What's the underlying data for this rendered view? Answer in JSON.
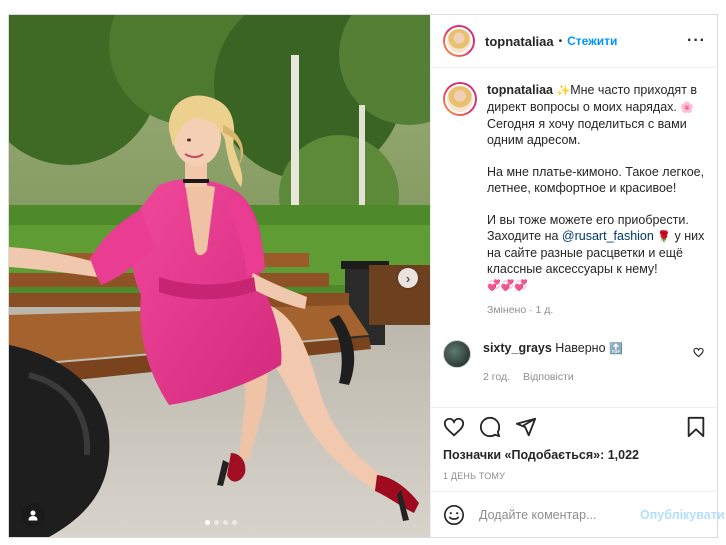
{
  "post": {
    "username": "topnataliaa",
    "bullet": "•",
    "follow_label": "Стежити",
    "more_label": "···"
  },
  "caption": {
    "username": "topnataliaa",
    "p1_a": "Мне часто приходят в директ вопросы о моих нарядах.",
    "p1_b": "Сегодня я хочу поделиться с вами одним адресом.",
    "p2": "На мне платье-кимоно. Такое легкое, летнее, комфортное и красивое!",
    "p3_a": "И вы тоже можете его приобрести. Заходите на",
    "p3_mention": "@rusart_fashion",
    "p3_b": "у них на сайте разные расцветки и ещё классные аксессуары к нему!",
    "emoji_prefix": "✨",
    "emoji_flower": "🌸",
    "emoji_rose": "🌹",
    "hearts": "💞💞💞",
    "meta": "Змінено · 1 д."
  },
  "comment": {
    "username": "sixty_grays",
    "text": "Наверно",
    "emoji": "🔝",
    "time": "2 год.",
    "reply_label": "Відповісти"
  },
  "actions": {
    "likes_text": "Позначки «Подобається»: 1,022",
    "timestamp": "1 ДЕНЬ ТОМУ"
  },
  "comment_box": {
    "placeholder": "Додайте коментар...",
    "publish_label": "Опублікувати"
  },
  "carousel": {
    "total_slides": 4,
    "active_index": 0,
    "next_icon": "chevron-right-icon"
  },
  "colors": {
    "accent": "#0095f6",
    "publish_disabled": "#b2dffc",
    "secondary_text": "#8e8e8e"
  }
}
